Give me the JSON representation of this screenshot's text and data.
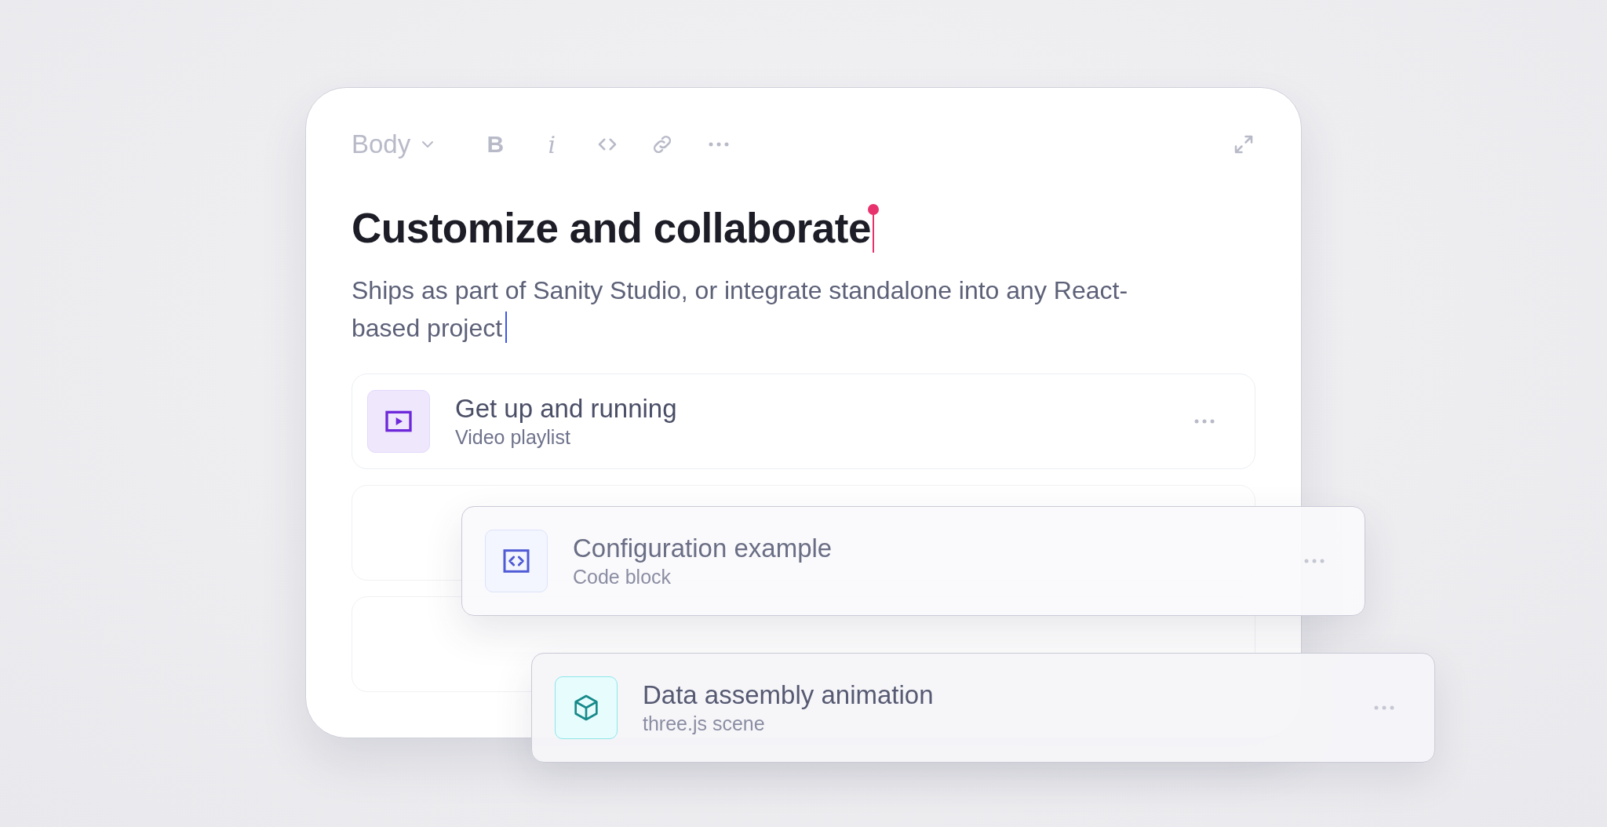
{
  "toolbar": {
    "style": "Body",
    "marks": [
      {
        "kind": "bold",
        "label": "B"
      },
      {
        "kind": "italic",
        "label": "i"
      },
      {
        "kind": "code"
      },
      {
        "kind": "link"
      },
      {
        "kind": "more"
      }
    ]
  },
  "heading": {
    "text": "Customize and collaborate",
    "presence_cursor": true
  },
  "paragraph": {
    "text": "Ships as part of Sanity Studio, or integrate standalone into any React-based project",
    "caret": true
  },
  "blocks": [
    {
      "kind": "video",
      "title": "Get up and running",
      "subtitle": "Video playlist",
      "floating": false
    },
    {
      "kind": "placeholder",
      "floating": false
    },
    {
      "kind": "placeholder",
      "floating": false
    },
    {
      "kind": "code",
      "title": "Configuration example",
      "subtitle": "Code block",
      "floating": true
    },
    {
      "kind": "scene",
      "title": "Data assembly animation",
      "subtitle": "three.js scene",
      "floating": true
    }
  ]
}
